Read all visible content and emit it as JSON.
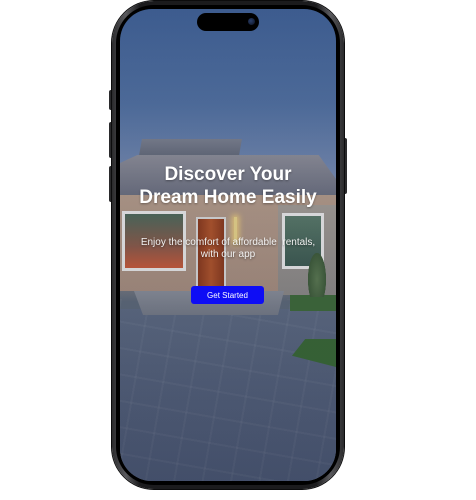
{
  "onboarding": {
    "headline_line1": "Discover Your",
    "headline_line2": "Dream Home Easily",
    "subtitle_line1": "Enjoy the comfort of affordable  rentals,",
    "subtitle_line2": "with our app",
    "cta_label": "Get Started"
  },
  "colors": {
    "cta_background": "#0e0df5",
    "text": "#ffffff",
    "phone_frame": "#1b1b1d"
  }
}
